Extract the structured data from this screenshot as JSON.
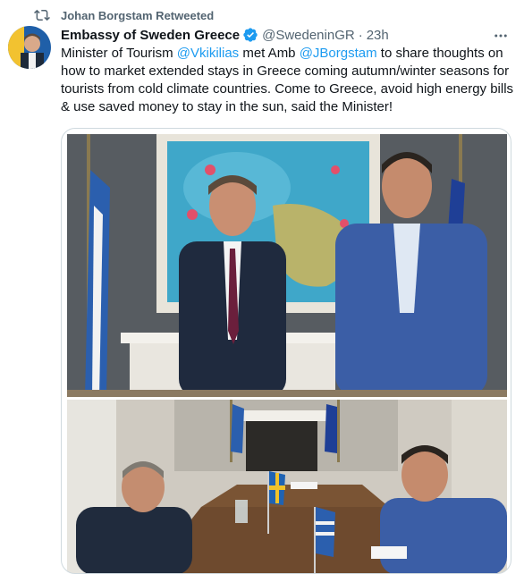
{
  "retweet": {
    "icon": "retweet-icon",
    "text": "Johan Borgstam Retweeted"
  },
  "tweet": {
    "author": {
      "display_name": "Embassy of Sweden Greece",
      "verified_icon": "verified-badge-icon",
      "handle": "@SwedeninGR",
      "separator": "·",
      "time": "23h",
      "avatar": "profile-avatar"
    },
    "text": {
      "part1": "Minister of Tourism ",
      "mention1": "@Vkikilias",
      "part2": " met Amb ",
      "mention2": "@JBorgstam",
      "part3": " to share thoughts on how to market extended stays in Greece coming autumn/winter seasons for tourists from cold climate countries. Come to Greece, avoid high energy bills & use saved money to stay in the sun, said the Minister!"
    },
    "media": {
      "photos": [
        "photo-two-men-standing-by-painting",
        "photo-meeting-at-table-with-flags"
      ]
    }
  },
  "colors": {
    "link": "#1d9bf0",
    "secondary_text": "#536471",
    "verified": "#1d9bf0",
    "border": "#cfd9de"
  }
}
